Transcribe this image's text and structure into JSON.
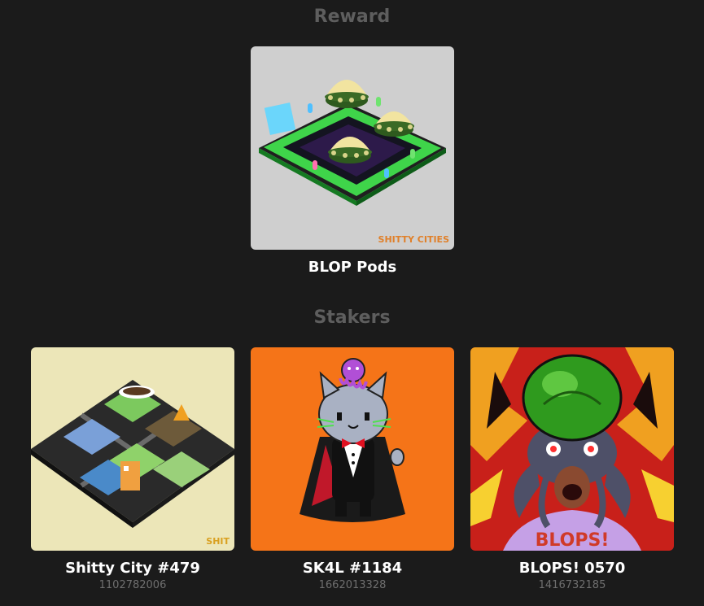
{
  "reward": {
    "heading": "Reward",
    "item": {
      "name": "BLOP Pods",
      "watermark": "SHITTY CITIES"
    }
  },
  "stakers": {
    "heading": "Stakers",
    "items": [
      {
        "name": "Shitty City #479",
        "id": "1102782006",
        "watermark": "SHIT"
      },
      {
        "name": "SK4L #1184",
        "id": "1662013328"
      },
      {
        "name": "BLOPS! 0570",
        "id": "1416732185",
        "shirt_text": "BLOPS!"
      }
    ]
  },
  "colors": {
    "background": "#1b1b1b",
    "heading": "#5e5e5e",
    "name": "#ffffff",
    "id": "#6f6f6f",
    "reward_bg": "#cfcfcf",
    "city_bg": "#ece6b8",
    "sk4l_bg": "#f57418"
  }
}
